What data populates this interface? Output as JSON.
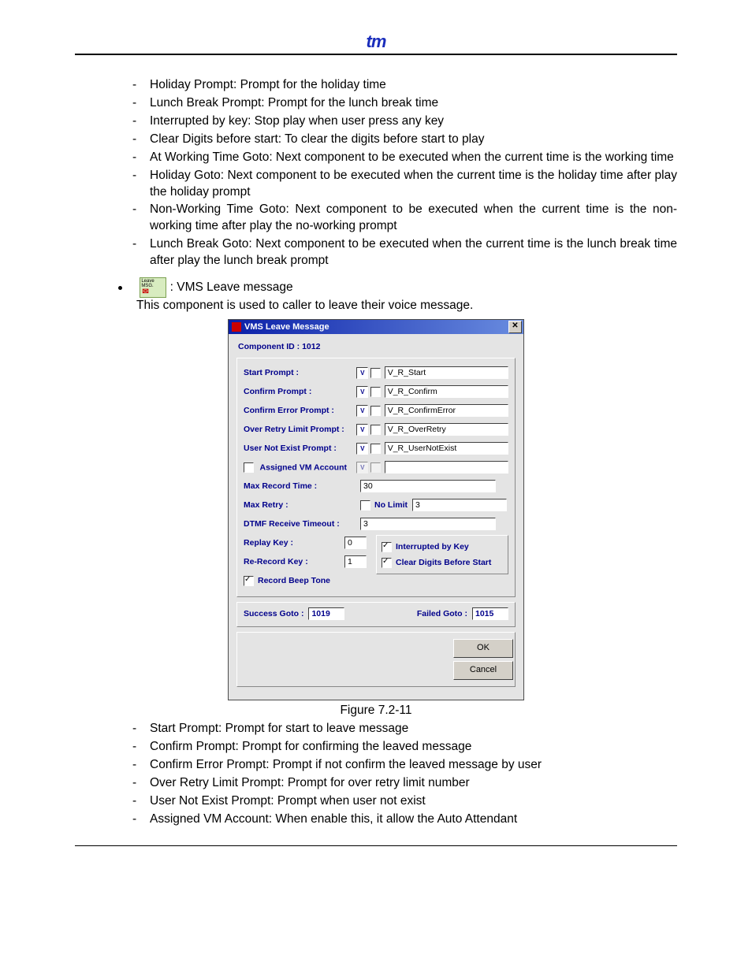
{
  "logo_text": "tm",
  "list_top": [
    "Holiday Prompt: Prompt for the holiday time",
    "Lunch Break Prompt: Prompt for the lunch break time",
    "Interrupted by key: Stop play when user press any key",
    "Clear Digits before start: To clear the digits before start to play",
    "At Working Time Goto: Next component to be executed when the current time is the working time",
    "Holiday Goto: Next component to be executed when the current time is the holiday time after play the holiday prompt",
    "Non-Working Time Goto: Next component to be executed when the current time is the non-working time after play the no-working prompt",
    "Lunch Break Goto: Next component to be executed when the current time is the lunch break time after play the lunch break prompt"
  ],
  "mini_icon_line1": "Leave",
  "mini_icon_line2": "MSG.",
  "bullet_title": ": VMS Leave message",
  "bullet_desc": "This component is used to caller to leave their voice message.",
  "dialog": {
    "title": "VMS Leave Message",
    "component_id_label": "Component ID : 1012",
    "rows": {
      "start_prompt": {
        "label": "Start Prompt :",
        "value": "V_R_Start"
      },
      "confirm_prompt": {
        "label": "Confirm Prompt :",
        "value": "V_R_Confirm"
      },
      "confirm_error": {
        "label": "Confirm Error Prompt :",
        "value": "V_R_ConfirmError"
      },
      "over_retry": {
        "label": "Over Retry Limit Prompt :",
        "value": "V_R_OverRetry"
      },
      "user_not_exist": {
        "label": "User Not Exist Prompt :",
        "value": "V_R_UserNotExist"
      },
      "assigned_vm": {
        "label": "Assigned VM Account",
        "value": ""
      },
      "max_record": {
        "label": "Max Record Time :",
        "value": "30"
      },
      "max_retry": {
        "label": "Max Retry :",
        "no_limit_label": "No Limit",
        "value": "3"
      },
      "dtmf_timeout": {
        "label": "DTMF Receive Timeout :",
        "value": "3"
      },
      "replay_key": {
        "label": "Replay Key :",
        "value": "0"
      },
      "rerecord_key": {
        "label": "Re-Record Key :",
        "value": "1"
      },
      "record_beep": {
        "label": "Record Beep Tone"
      },
      "interrupted": {
        "label": "Interrupted by Key"
      },
      "clear_digits": {
        "label": "Clear Digits Before Start"
      }
    },
    "success_goto_label": "Success Goto :",
    "success_goto_value": "1019",
    "failed_goto_label": "Failed Goto :",
    "failed_goto_value": "1015",
    "ok": "OK",
    "cancel": "Cancel"
  },
  "figure_caption": "Figure 7.2-11",
  "list_bottom": [
    "Start Prompt: Prompt for start to leave message",
    "Confirm Prompt: Prompt for confirming the leaved message",
    "Confirm Error Prompt: Prompt if not confirm the leaved message by user",
    "Over Retry Limit Prompt: Prompt for over retry limit number",
    "User Not Exist Prompt: Prompt when user not exist",
    "Assigned VM Account: When enable this, it allow the Auto Attendant"
  ]
}
